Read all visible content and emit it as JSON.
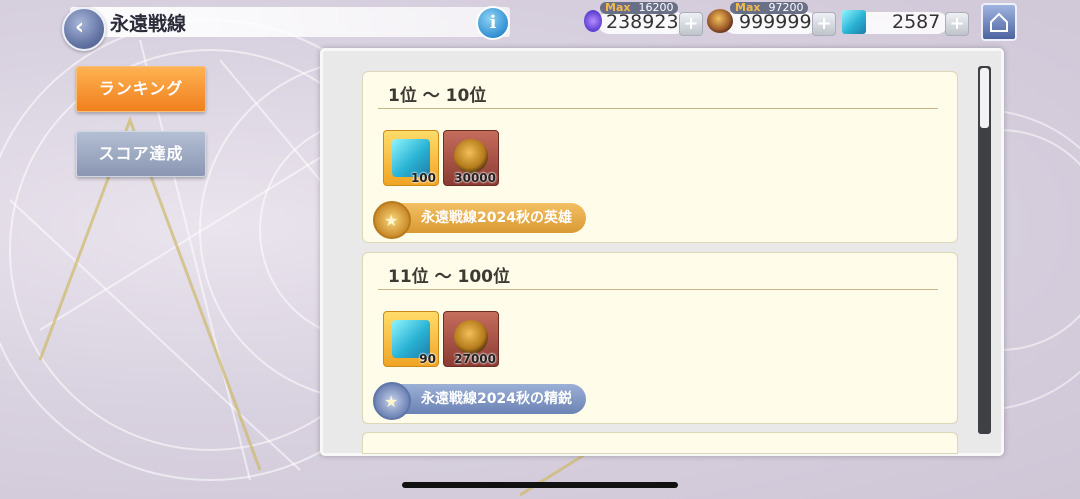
{
  "header": {
    "title": "永遠戦線",
    "info_icon": "i"
  },
  "resources": [
    {
      "icon": "crystal-currency-icon",
      "value": "238923",
      "max_label": "Max",
      "max_value": "16200"
    },
    {
      "icon": "horn-currency-icon",
      "value": "999999",
      "max_label": "Max",
      "max_value": "97200"
    },
    {
      "icon": "cube-currency-icon",
      "value": "2587"
    }
  ],
  "nav": {
    "ranking": "ランキング",
    "score": "スコア達成"
  },
  "tiers": [
    {
      "title": "1位 ～ 10位",
      "rewards": [
        {
          "icon": "cube-item-icon",
          "qty": "100"
        },
        {
          "icon": "horn-item-icon",
          "qty": "30000"
        }
      ],
      "badge": "永遠戦線2024秋の英雄",
      "badge_color": "#d99a33"
    },
    {
      "title": "11位 ～ 100位",
      "rewards": [
        {
          "icon": "cube-item-icon",
          "qty": "90"
        },
        {
          "icon": "horn-item-icon",
          "qty": "27000"
        }
      ],
      "badge": "永遠戦線2024秋の精鋭",
      "badge_color": "#6b82b4"
    }
  ]
}
